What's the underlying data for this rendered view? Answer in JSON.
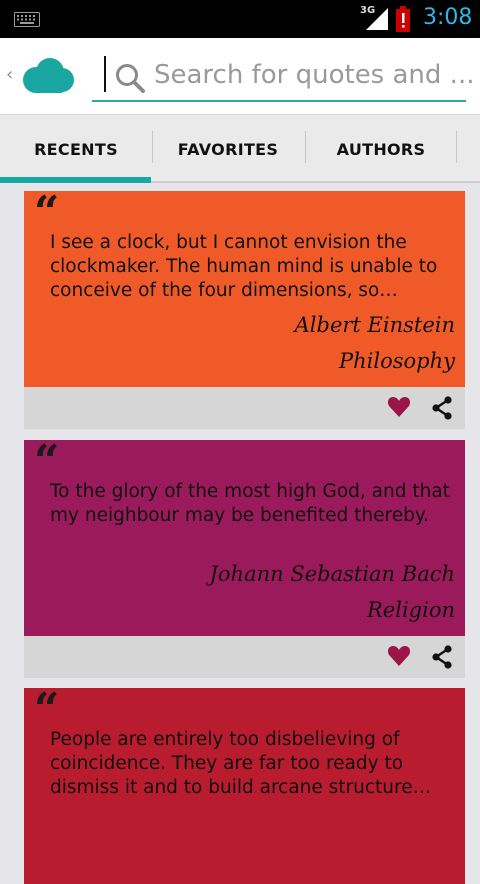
{
  "status_bar": {
    "network_label": "3G",
    "time": "3:08"
  },
  "action_bar": {
    "search_placeholder": "Search for quotes and ..."
  },
  "tabs": [
    {
      "label": "RECENTS",
      "selected": true
    },
    {
      "label": "FAVORITES",
      "selected": false
    },
    {
      "label": "AUTHORS",
      "selected": false
    }
  ],
  "colors": {
    "accent": "#18a8a3",
    "card_1": "#f05a28",
    "card_2": "#9b1a5c",
    "card_3": "#b81c2e",
    "heart": "#9b1646"
  },
  "quotes": [
    {
      "text": "I see a clock, but I cannot envision the clockmaker. The human mind is unable to conceive of the four dimensions, so…",
      "author": "Albert Einstein",
      "category": "Philosophy"
    },
    {
      "text": "To the glory of the most high God, and that my neighbour may be benefited thereby.",
      "author": "Johann Sebastian Bach",
      "category": "Religion"
    },
    {
      "text": "People are entirely too disbelieving of coincidence. They are far too ready to dismiss it and to build arcane structure…",
      "author": "",
      "category": ""
    }
  ],
  "icons": {
    "quote": "“",
    "up": "‹"
  }
}
